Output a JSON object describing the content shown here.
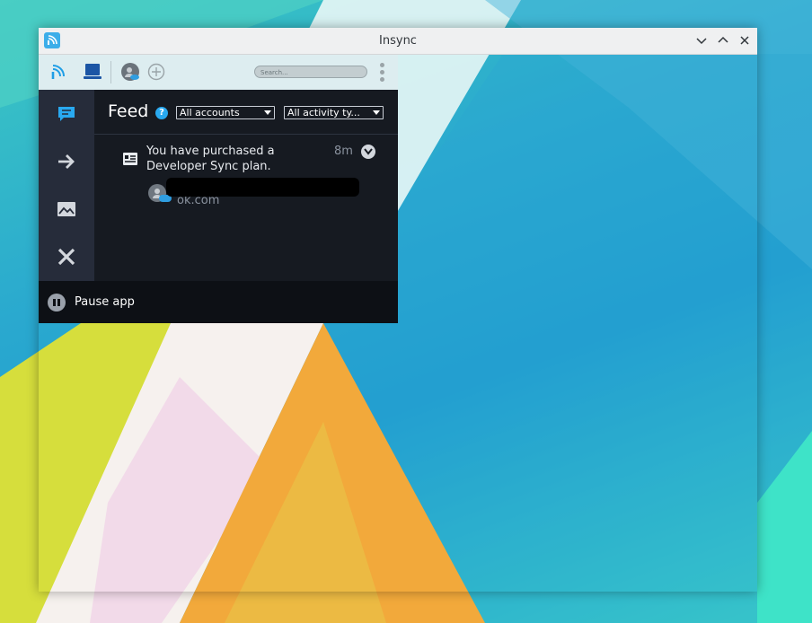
{
  "window": {
    "title": "Insync",
    "icon": "insync-app-icon",
    "controls": [
      "minimize-icon",
      "maximize-icon",
      "close-icon"
    ]
  },
  "toolbar": {
    "icons": [
      "insync-logo-icon",
      "laptop-icon",
      "account-avatar",
      "add-account-icon",
      "more-options-icon"
    ],
    "search_placeholder": "Search..."
  },
  "sidebar": {
    "items": [
      {
        "name": "feed",
        "icon": "chat-bubble-icon",
        "active": true
      },
      {
        "name": "outgoing",
        "icon": "arrow-right-icon",
        "active": false
      },
      {
        "name": "media",
        "icon": "image-icon",
        "active": false
      },
      {
        "name": "errors",
        "icon": "close-icon",
        "active": false
      }
    ]
  },
  "feed": {
    "title": "Feed",
    "account_filter": "All accounts",
    "activity_filter": "All activity ty..."
  },
  "feed_items": [
    {
      "icon": "receipt-icon",
      "message": "You have purchased a Developer Sync plan.",
      "time": "8m",
      "account_suffix": "ok.com"
    }
  ],
  "footer": {
    "pause_label": "Pause app"
  },
  "colors": {
    "accent": "#29a9f0",
    "panel_bg": "#161a21",
    "sidebar_bg": "#262c3a",
    "toolbar_bg": "#ddedf0"
  }
}
